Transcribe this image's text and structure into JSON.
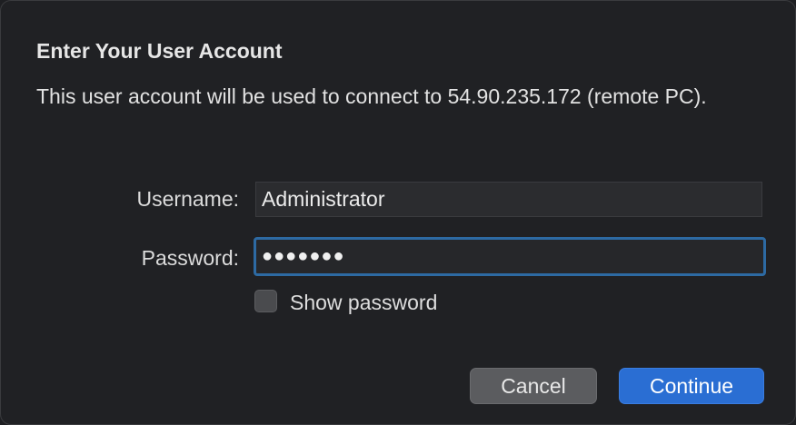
{
  "dialog": {
    "title": "Enter Your User Account",
    "message": "This user account will be used to connect to 54.90.235.172 (remote PC).",
    "username_label": "Username:",
    "username_value": "Administrator",
    "password_label": "Password:",
    "password_masked": "●●●●●●●",
    "show_password_label": "Show password",
    "show_password_checked": false,
    "cancel_label": "Cancel",
    "continue_label": "Continue"
  },
  "colors": {
    "background": "#202124",
    "focus_ring": "#2d6aa3",
    "primary_button": "#2a6ed3",
    "secondary_button": "#5b5c5f"
  }
}
